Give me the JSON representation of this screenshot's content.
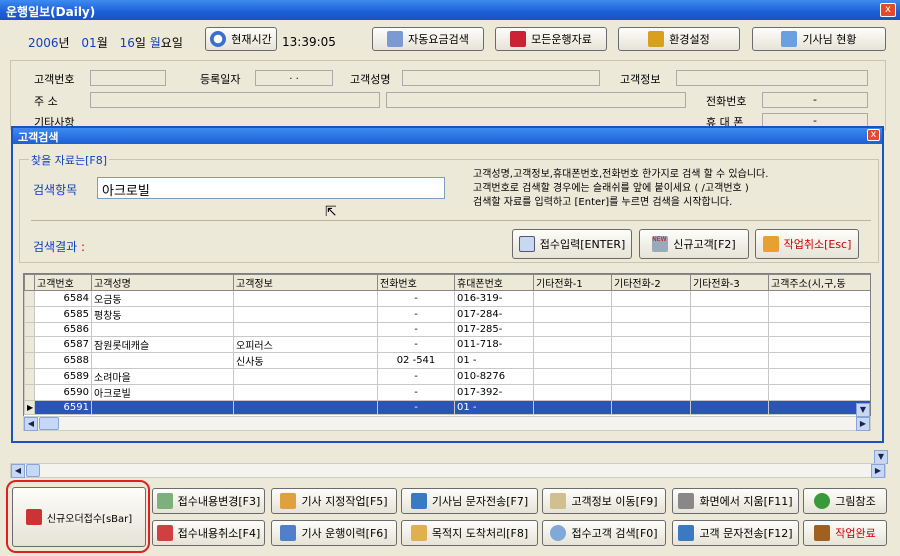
{
  "window": {
    "title": "운행일보(Daily)",
    "close": "x"
  },
  "dateline": {
    "year": "2006",
    "year_u": "년",
    "month": "01",
    "month_u": "월",
    "day": "16",
    "day_u": "일",
    "weekday": "월",
    "weekday_u": "요일"
  },
  "toolbar": {
    "now_btn": "현재시간",
    "time": "13:39:05",
    "auto_fare": "자동요금검색",
    "all_records": "모든운행자료",
    "settings": "환경설정",
    "drivers": "기사님 현황"
  },
  "customer": {
    "id_label": "고객번호",
    "reg_label": "등록일자",
    "reg_value": ".   .",
    "name_label": "고객성명",
    "info_label": "고객정보",
    "addr_label": "주       소",
    "phone_label": "전화번호",
    "phone_value": "-",
    "etc_label": "기타사항",
    "mobile_label": "휴 대 폰",
    "mobile_value": "-"
  },
  "dialog": {
    "title": "고객검색",
    "group": "찾을 자료는[F8]",
    "search_label": "검색항목",
    "search_value": "아크로빌",
    "help": [
      "고객성명,고객정보,휴대폰번호,전화번호 한가지로 검색 할 수 있습니다.",
      "고객번호로 검색할 경우에는 슬래쉬를 앞에 붙이세요 ( /고객번호 )",
      "검색할 자료를 입력하고 [Enter]를 누르면 검색을 시작합니다."
    ],
    "result_label": "검색결과",
    "result_mark": ":",
    "btn_receive": "접수입력[ENTER]",
    "btn_new": "신규고객[F2]",
    "btn_cancel": "작업취소[Esc]",
    "new_badge": "NEW"
  },
  "grid": {
    "columns": [
      "고객번호",
      "고객성명",
      "고객정보",
      "전화번호",
      "휴대폰번호",
      "기타전화-1",
      "기타전화-2",
      "기타전화-3",
      "고객주소(시,구,동"
    ],
    "rows": [
      [
        "6584",
        "오금동",
        "",
        "-",
        "016-319-",
        "",
        "",
        "",
        ""
      ],
      [
        "6585",
        "평창동",
        "",
        "-",
        "017-284-",
        "",
        "",
        "",
        ""
      ],
      [
        "6586",
        "",
        "",
        "-",
        "017-285-",
        "",
        "",
        "",
        ""
      ],
      [
        "6587",
        "잠원롯데캐슬",
        "오피러스",
        "-",
        "011-718-",
        "",
        "",
        "",
        ""
      ],
      [
        "6588",
        "",
        "신사동",
        "02   -541",
        "01  -",
        "",
        "",
        "",
        ""
      ],
      [
        "6589",
        "소려마을",
        "",
        "-",
        "010-8276",
        "",
        "",
        "",
        ""
      ],
      [
        "6590",
        "아크로빌",
        "",
        "-",
        "017-392-",
        "",
        "",
        "",
        ""
      ],
      [
        "6591",
        "",
        "",
        "-",
        "01  -",
        "",
        "",
        "",
        ""
      ]
    ],
    "selected_row": 7
  },
  "bottom": {
    "new_order": "신규오더접수[sBar]",
    "b1": "접수내용변경[F3]",
    "b2": "기사 지정작업[F5]",
    "b3": "기사님 문자전송[F7]",
    "b4": "고객정보 이동[F9]",
    "b5": "화면에서 지움[F11]",
    "b6": "그림참조",
    "b7": "접수내용취소[F4]",
    "b8": "기사 운행이력[F6]",
    "b9": "목적지 도착처리[F8]",
    "b10": "접수고객 검색[F0]",
    "b11": "고객 문자전송[F12]",
    "b12": "작업완료"
  },
  "colors": {
    "accent_blue": "#1a52c0",
    "highlight_yellow": "#ffff33",
    "selection": "#2b54b5",
    "red_outline": "#e02020"
  }
}
